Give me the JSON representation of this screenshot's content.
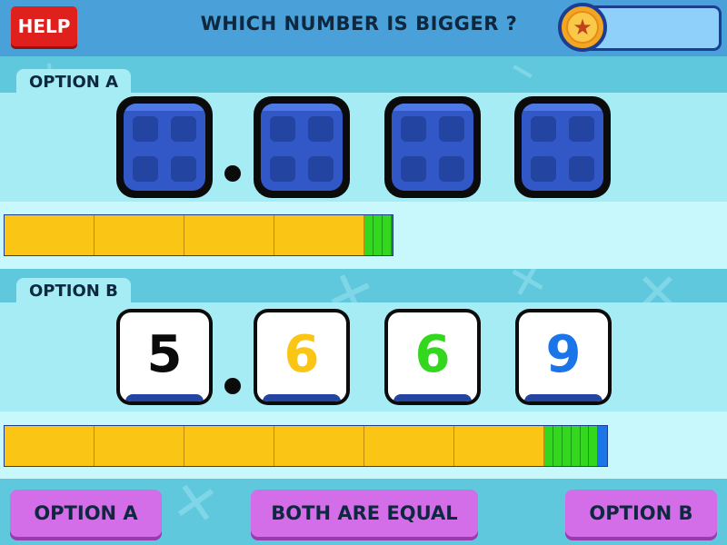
{
  "header": {
    "help_label": "HELP",
    "question": "WHICH NUMBER IS BIGGER ?",
    "medal_icon": "star-medal-icon",
    "progress": 0
  },
  "option_a": {
    "label": "OPTION A",
    "hidden_digits": 4,
    "bar": {
      "units": 4,
      "tenths": 3,
      "hundredths": 1
    }
  },
  "option_b": {
    "label": "OPTION B",
    "digits": [
      "5",
      "6",
      "6",
      "9"
    ],
    "digit_colors": [
      "#0b0b0b",
      "#fbc516",
      "#33d81e",
      "#1b74e8"
    ],
    "bar": {
      "units": 6,
      "tenths": 6,
      "hundredths": 9
    }
  },
  "answers": {
    "option_a": "OPTION A",
    "equal": "BOTH ARE EQUAL",
    "option_b": "OPTION B"
  },
  "colors": {
    "units": "#fbc516",
    "tenths": "#33d81e",
    "hundredths": "#1b74e8",
    "button": "#d46ee8",
    "help": "#e0201c"
  }
}
